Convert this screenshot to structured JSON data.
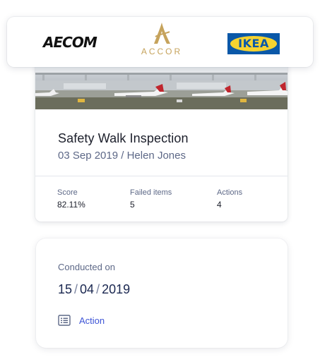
{
  "logos": {
    "aecom": "AECOM",
    "accor": "ACCOR",
    "ikea": "IKEA"
  },
  "inspection": {
    "photo_icon": "airport-planes-photo",
    "title": "Safety Walk Inspection",
    "subtitle": "03 Sep 2019 / Helen Jones",
    "stats": {
      "score_label": "Score",
      "score_value": "82.11%",
      "failed_label": "Failed items",
      "failed_value": "5",
      "actions_label": "Actions",
      "actions_value": "4"
    }
  },
  "conducted": {
    "label": "Conducted on",
    "day": "15",
    "month": "04",
    "year": "2019",
    "separator": "/",
    "action_icon": "list-icon",
    "action_label": "Action"
  },
  "colors": {
    "accent": "#3d54d6",
    "muted_text": "#5d6887",
    "date_text": "#1a2750",
    "accor_gold": "#c6a35c",
    "ikea_blue": "#0a58a8",
    "ikea_yellow": "#f6d330"
  }
}
